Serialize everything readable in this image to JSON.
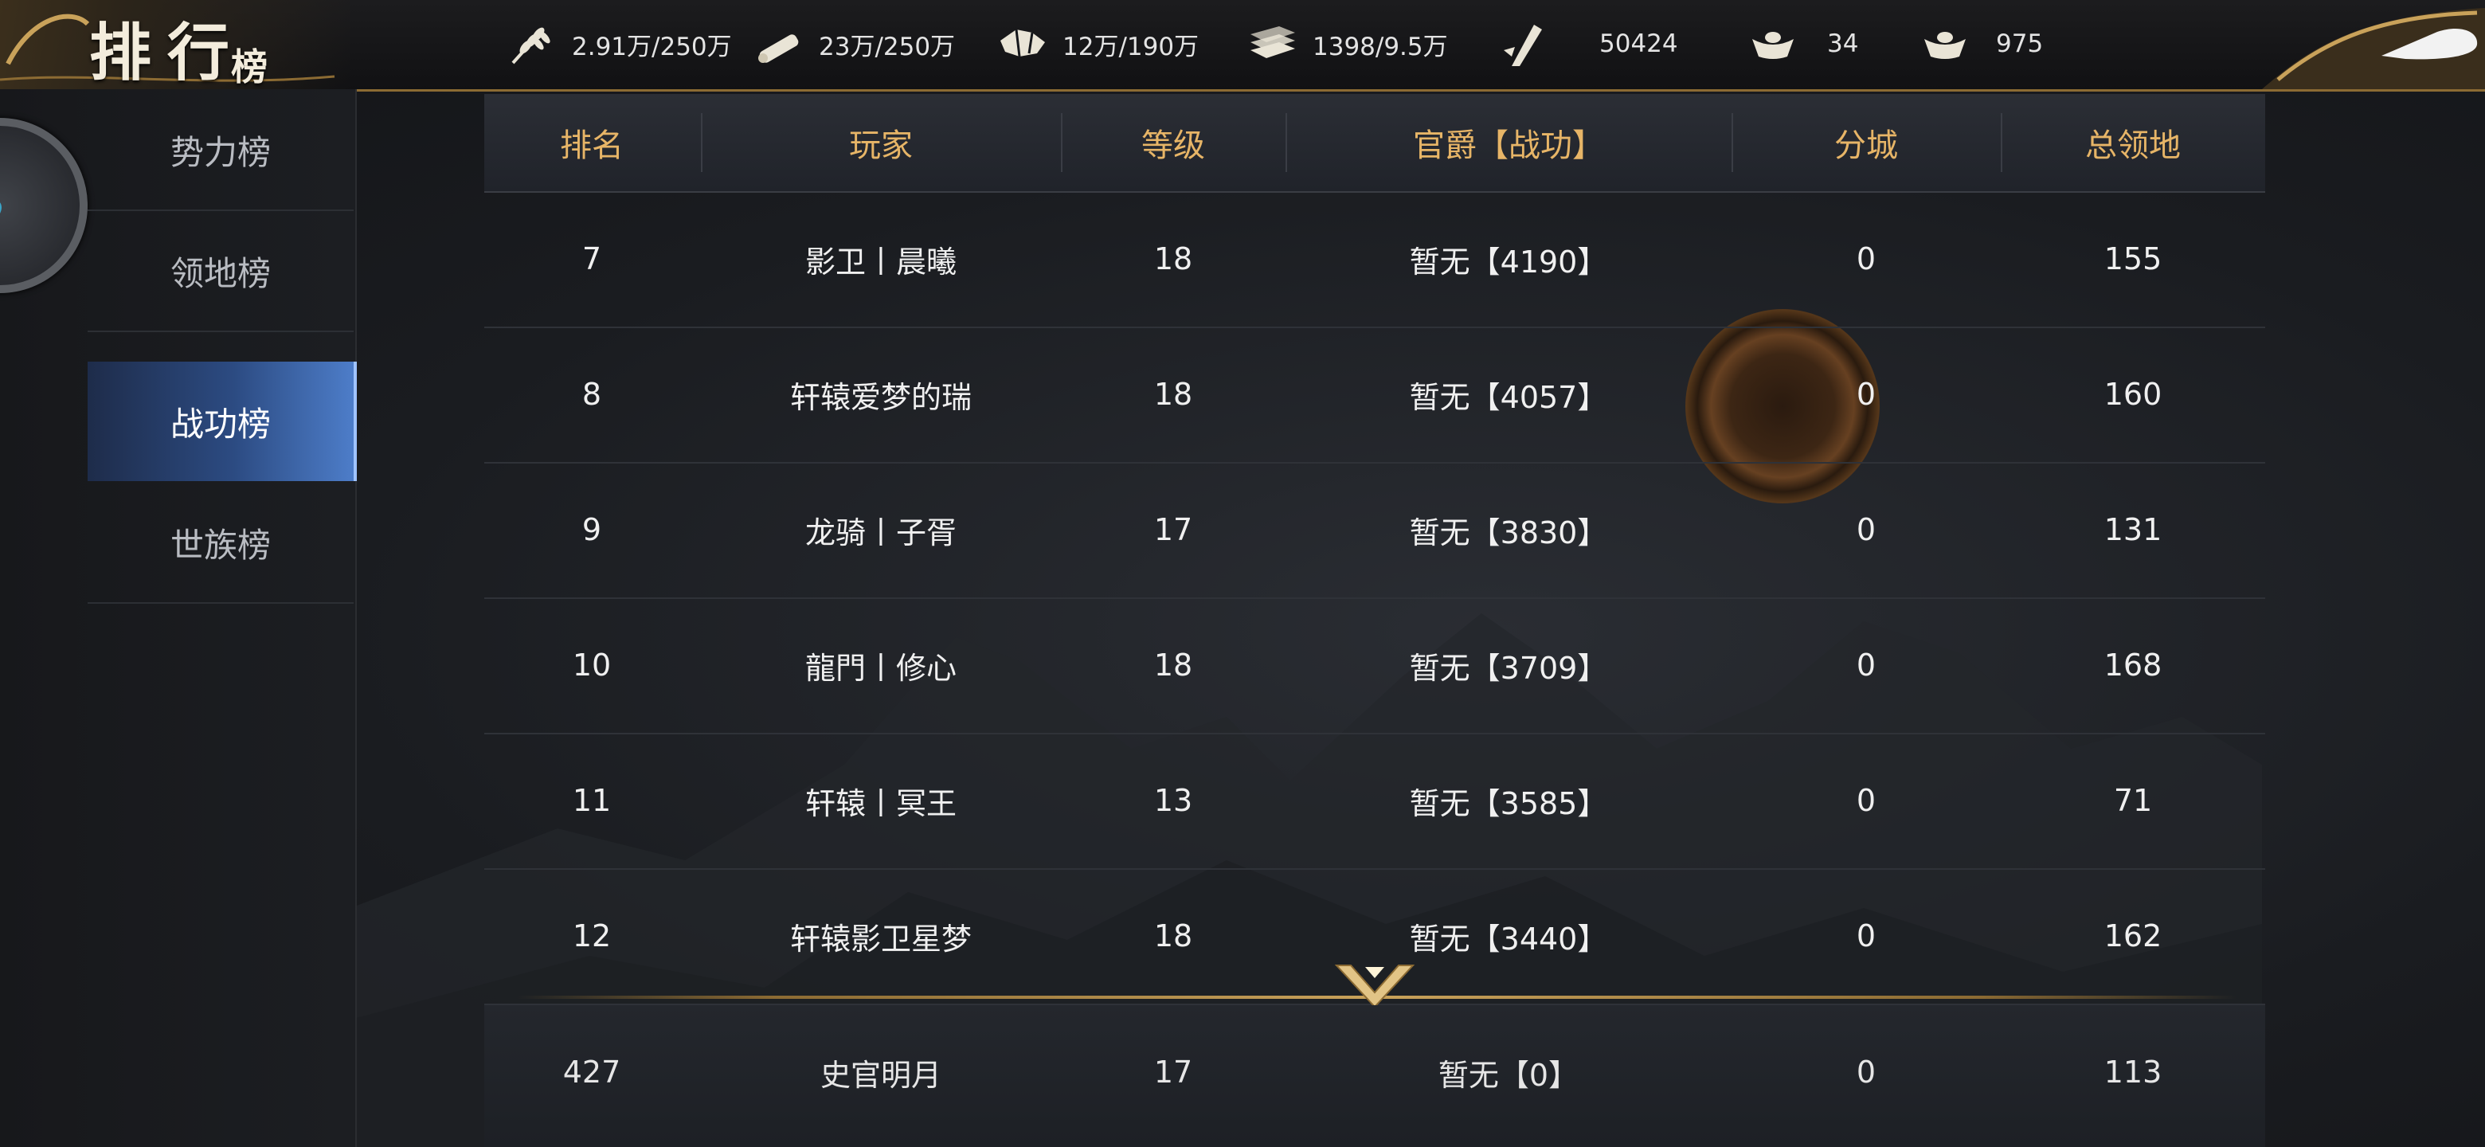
{
  "header": {
    "title_big": "排行",
    "title_small": "榜",
    "resources": [
      {
        "icon": "grain-icon",
        "value": "2.91万/250万"
      },
      {
        "icon": "wood-icon",
        "value": "23万/250万"
      },
      {
        "icon": "stone-icon",
        "value": "12万/190万"
      },
      {
        "icon": "iron-icon",
        "value": "1398/9.5万"
      },
      {
        "icon": "copper-icon",
        "value": "50424"
      },
      {
        "icon": "gold-ingot-icon",
        "value": "34"
      },
      {
        "icon": "silver-ingot-icon",
        "value": "975"
      }
    ]
  },
  "sidebar": {
    "items": [
      {
        "label": "势力榜",
        "active": false
      },
      {
        "label": "领地榜",
        "active": false
      },
      {
        "label": "战功榜",
        "active": true
      },
      {
        "label": "世族榜",
        "active": false
      }
    ]
  },
  "table": {
    "columns": [
      "排名",
      "玩家",
      "等级",
      "官爵【战功】",
      "分城",
      "总领地"
    ],
    "rows": [
      {
        "rank": "7",
        "player": "影卫丨晨曦",
        "level": "18",
        "title": "暂无【4190】",
        "branch": "0",
        "territory": "155"
      },
      {
        "rank": "8",
        "player": "轩辕爱梦的瑞",
        "level": "18",
        "title": "暂无【4057】",
        "branch": "0",
        "territory": "160"
      },
      {
        "rank": "9",
        "player": "龙骑丨子胥",
        "level": "17",
        "title": "暂无【3830】",
        "branch": "0",
        "territory": "131"
      },
      {
        "rank": "10",
        "player": "龍門丨修心",
        "level": "18",
        "title": "暂无【3709】",
        "branch": "0",
        "territory": "168"
      },
      {
        "rank": "11",
        "player": "轩辕丨冥王",
        "level": "13",
        "title": "暂无【3585】",
        "branch": "0",
        "territory": "71"
      },
      {
        "rank": "12",
        "player": "轩辕影卫星梦",
        "level": "18",
        "title": "暂无【3440】",
        "branch": "0",
        "territory": "162"
      }
    ],
    "self": {
      "rank": "427",
      "player": "史官明月",
      "level": "17",
      "title": "暂无【0】",
      "branch": "0",
      "territory": "113"
    }
  },
  "colors": {
    "accent_gold": "#e7b567",
    "active_tab": "#4d7dc9",
    "border_gold": "#8c6b33"
  }
}
